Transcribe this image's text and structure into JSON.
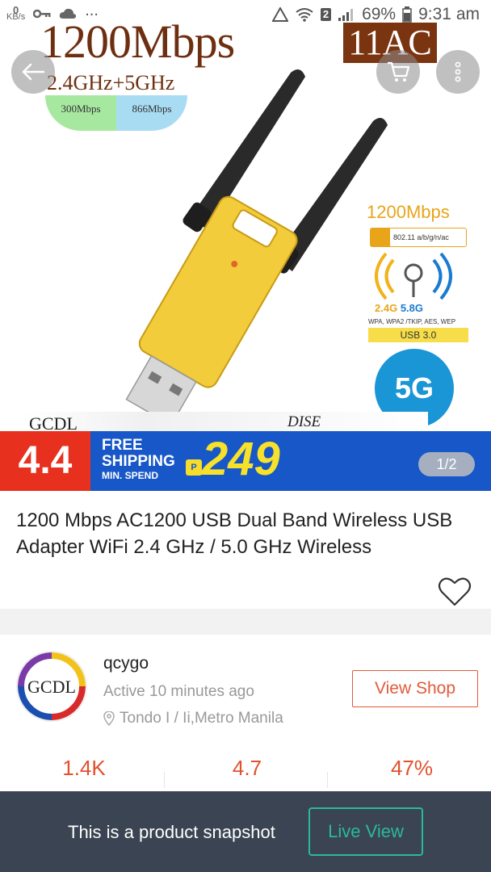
{
  "status_bar": {
    "kbs_value": "0",
    "kbs_unit": "KB/s",
    "dots": "...",
    "sim": "2",
    "battery": "69%",
    "time": "9:31 am"
  },
  "hero": {
    "headline": "1200Mbps",
    "frequency": "2.4GHz+5GHz",
    "speed_low": "300Mbps",
    "speed_high": "866Mbps",
    "ac_badge": "11AC",
    "spec_speed": "1200Mbps",
    "spec_standard": "802.11 a/b/g/n/ac",
    "spec_band_a": "2.4G",
    "spec_band_b": "5.8G",
    "spec_security": "WPA, WPA2 /TKIP, AES, WEP",
    "spec_usb": "USB 3.0",
    "five_g": "5G",
    "brand_strip": "GCDL",
    "brand_strip_tail": "DISE",
    "promo": {
      "sale_date": "4.4",
      "free_line1": "FREE",
      "free_line2": "SHIPPING",
      "min_spend": "MIN. SPEND",
      "peso": "P",
      "amount": "249"
    },
    "page_indicator": "1/2"
  },
  "product": {
    "title": "1200 Mbps AC1200 USB Dual Band Wireless USB Adapter WiFi 2.4 GHz / 5.0 GHz Wireless"
  },
  "shop": {
    "logo_text": "GCDL",
    "name": "qcygo",
    "active": "Active 10 minutes ago",
    "location": "Tondo I / Ii,Metro Manila",
    "view_shop_label": "View Shop",
    "stats": [
      "1.4K",
      "4.7",
      "47%"
    ]
  },
  "snapshot_bar": {
    "message": "This is a product snapshot",
    "live_view_label": "Live View"
  },
  "colors": {
    "accent": "#e25a3a",
    "teal": "#2bb8a0",
    "snapbar_bg": "#3a4452"
  }
}
